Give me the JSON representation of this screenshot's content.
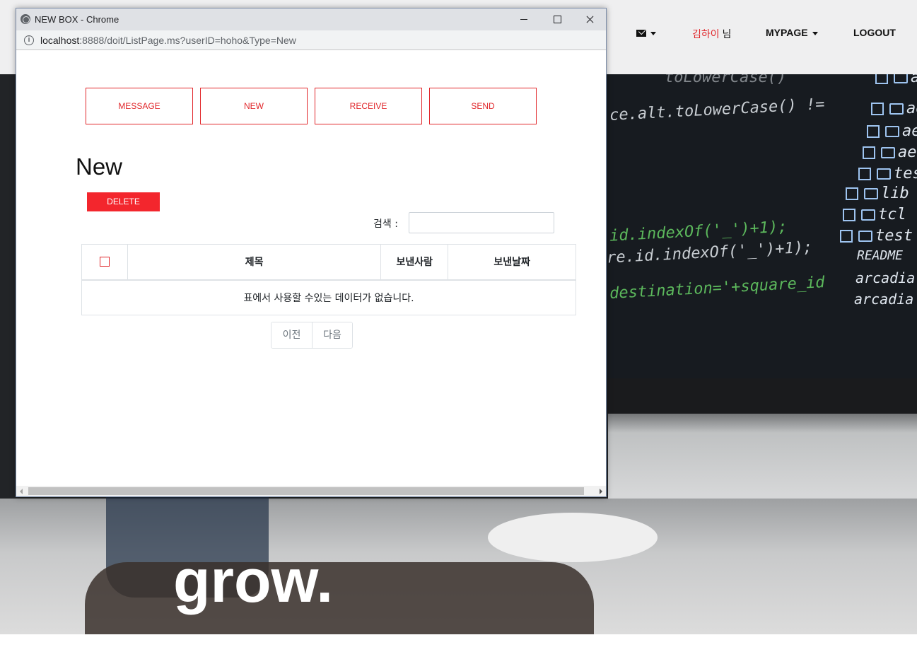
{
  "site": {
    "nav": {
      "user_name": "김하이",
      "user_suffix": " 님",
      "mypage": "MYPAGE",
      "logout": "LOGOUT"
    },
    "hero_word": "grow.",
    "code_lines": [
      "toLowerCase()",
      "ce.alt.toLowerCase() !=",
      "id.indexOf('_')+1);",
      "re.id.indexOf('_')+1);",
      "destination='+square_id"
    ],
    "tree_items": [
      "ac",
      "ae",
      "ae",
      "ae-",
      "tes",
      "lib",
      "tcl",
      "test",
      "README",
      "arcadia",
      "arcadia"
    ]
  },
  "window": {
    "title": "NEW BOX - Chrome",
    "url_host": "localhost",
    "url_rest": ":8888/doit/ListPage.ms?userID=hoho&Type=New"
  },
  "page": {
    "tabs": [
      "MESSAGE",
      "NEW",
      "RECEIVE",
      "SEND"
    ],
    "heading": "New",
    "delete_label": "DELETE",
    "search_label": "검색 :",
    "search_value": "",
    "table": {
      "headers": [
        "제목",
        "보낸사람",
        "보낸날짜"
      ],
      "empty_message": "표에서 사용할 수있는 데이터가 없습니다."
    },
    "pager": {
      "prev": "이전",
      "next": "다음"
    }
  },
  "colors": {
    "accent": "#e1272b",
    "delete_bg": "#f3262d"
  }
}
